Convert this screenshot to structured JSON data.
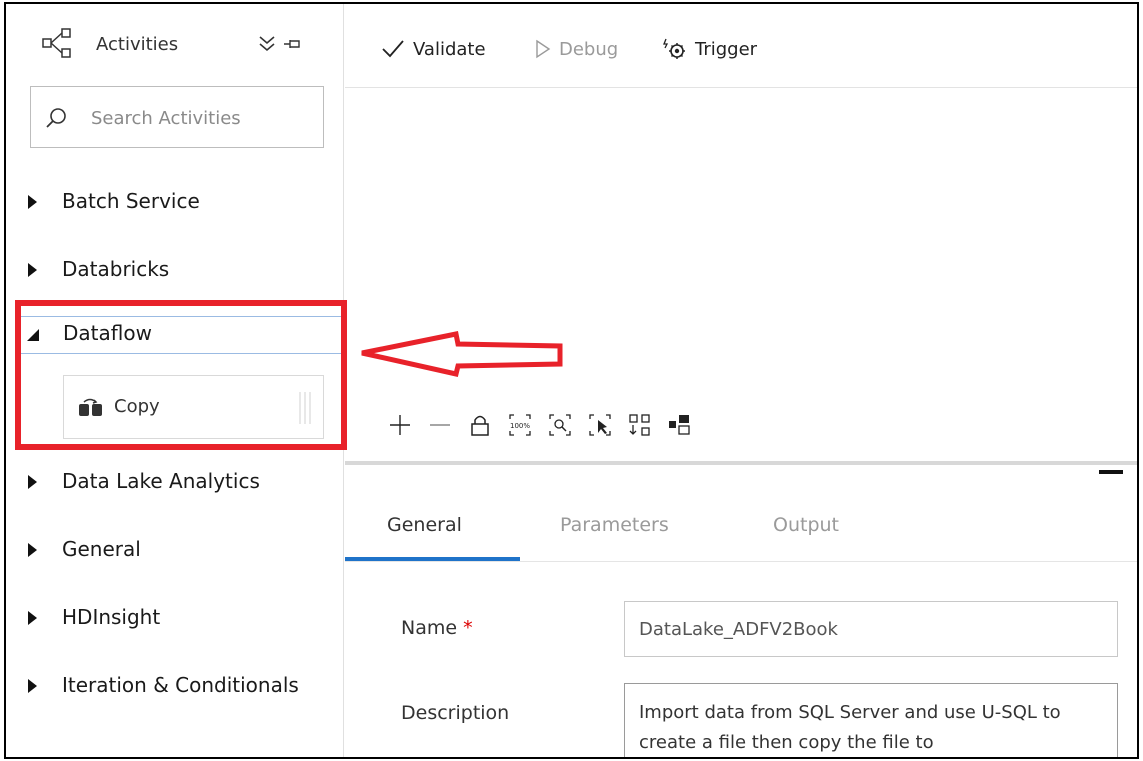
{
  "sidebar": {
    "title": "Activities",
    "search_placeholder": "Search Activities",
    "categories": [
      {
        "label": "Batch Service"
      },
      {
        "label": "Databricks"
      },
      {
        "label": "Dataflow"
      },
      {
        "label": "Data Lake Analytics"
      },
      {
        "label": "General"
      },
      {
        "label": "HDInsight"
      },
      {
        "label": "Iteration & Conditionals"
      }
    ],
    "dataflow_items": [
      {
        "label": "Copy"
      }
    ]
  },
  "toolbar": {
    "validate_label": "Validate",
    "debug_label": "Debug",
    "trigger_label": "Trigger"
  },
  "properties": {
    "tabs": [
      {
        "label": "General"
      },
      {
        "label": "Parameters"
      },
      {
        "label": "Output"
      }
    ],
    "name_label": "Name",
    "required_marker": "*",
    "name_value": "DataLake_ADFV2Book",
    "description_label": "Description",
    "description_value": "Import data from SQL Server and use U-SQL to create a file then copy the file to"
  },
  "colors": {
    "highlight": "#e8222a",
    "accent": "#1f73c9"
  },
  "icons": [
    "pipeline-icon",
    "collapse-all-icon",
    "pin-icon",
    "search-icon",
    "copy-activity-icon",
    "validate-check-icon",
    "debug-play-icon",
    "trigger-icon",
    "zoom-in-icon",
    "zoom-out-icon",
    "lock-icon",
    "zoom-100-icon",
    "zoom-to-fit-icon",
    "multi-select-icon",
    "auto-align-icon",
    "layout-icon",
    "annotation-arrow-icon"
  ]
}
